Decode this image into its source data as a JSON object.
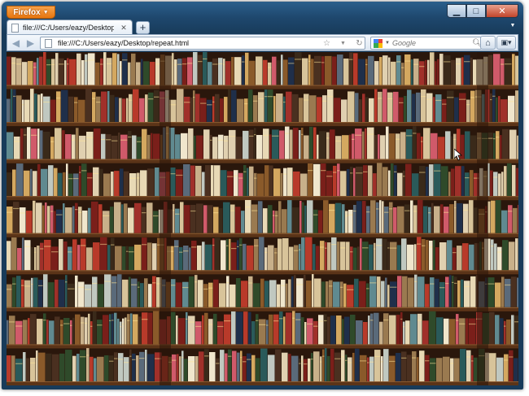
{
  "browser": {
    "app_button_label": "Firefox",
    "tab_title": "file:///C:/Users/eazy/Desktop/repeat.html",
    "new_tab_label": "+",
    "url": "file:///C:/Users/eazy/Desktop/repeat.html",
    "search_placeholder": "Google",
    "caption_min": "▁",
    "caption_max": "□",
    "caption_close": "✕"
  },
  "content": {
    "description_icon": "bookshelf-wallpaper-image",
    "shelf_rows": 9
  },
  "colors": {
    "firefox_orange": "#e7760f",
    "title_bar": "#1e476d",
    "shelf_wood": "#5b3418"
  }
}
